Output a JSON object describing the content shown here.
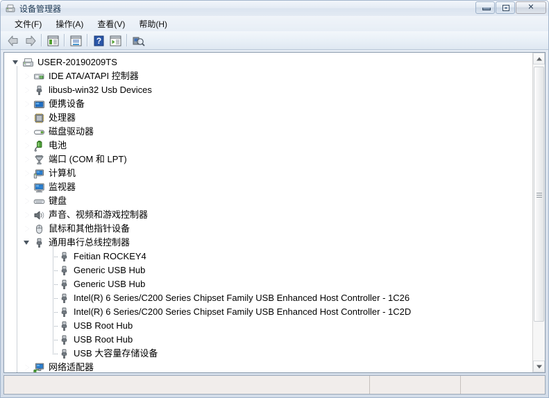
{
  "window": {
    "title": "设备管理器",
    "title_icon": "device-manager-icon",
    "buttons": {
      "minimize": "minimize-button",
      "maximize": "maximize-button",
      "close": "close-button",
      "close_glyph": "✕"
    }
  },
  "menu": {
    "items": [
      {
        "label": "文件(F)",
        "name": "menu-file"
      },
      {
        "label": "操作(A)",
        "name": "menu-action"
      },
      {
        "label": "查看(V)",
        "name": "menu-view"
      },
      {
        "label": "帮助(H)",
        "name": "menu-help"
      }
    ]
  },
  "toolbar": {
    "buttons": [
      {
        "name": "back-button",
        "icon": "back-arrow-icon"
      },
      {
        "name": "forward-button",
        "icon": "forward-arrow-icon"
      },
      {
        "name": "separator-1",
        "icon": "separator"
      },
      {
        "name": "show-hide-console-tree-button",
        "icon": "console-tree-icon"
      },
      {
        "name": "separator-2",
        "icon": "separator"
      },
      {
        "name": "properties-button",
        "icon": "properties-window-icon"
      },
      {
        "name": "separator-3",
        "icon": "separator"
      },
      {
        "name": "help-button",
        "icon": "question-mark-icon",
        "glyph": "?"
      },
      {
        "name": "update-driver-button",
        "icon": "play-window-icon"
      },
      {
        "name": "separator-4",
        "icon": "separator"
      },
      {
        "name": "scan-hardware-changes-button",
        "icon": "scan-magnifier-icon"
      }
    ]
  },
  "tree": {
    "root": {
      "label": "USER-20190209TS",
      "icon": "computer-root-icon",
      "expanded": true,
      "indent": 0
    },
    "nodes": [
      {
        "label": "IDE ATA/ATAPI 控制器",
        "icon": "ide-controller-icon",
        "state": "collapsed",
        "indent": 1
      },
      {
        "label": "libusb-win32 Usb Devices",
        "icon": "usb-plug-icon",
        "state": "collapsed",
        "indent": 1
      },
      {
        "label": "便携设备",
        "icon": "portable-device-icon",
        "state": "collapsed",
        "indent": 1
      },
      {
        "label": "处理器",
        "icon": "processor-icon",
        "state": "collapsed",
        "indent": 1
      },
      {
        "label": "磁盘驱动器",
        "icon": "disk-drive-icon",
        "state": "collapsed",
        "indent": 1
      },
      {
        "label": "电池",
        "icon": "battery-icon",
        "state": "collapsed",
        "indent": 1
      },
      {
        "label": "端口 (COM 和 LPT)",
        "icon": "ports-icon",
        "state": "collapsed",
        "indent": 1
      },
      {
        "label": "计算机",
        "icon": "computer-icon",
        "state": "collapsed",
        "indent": 1
      },
      {
        "label": "监视器",
        "icon": "monitor-icon",
        "state": "collapsed",
        "indent": 1
      },
      {
        "label": "键盘",
        "icon": "keyboard-icon",
        "state": "collapsed",
        "indent": 1
      },
      {
        "label": "声音、视频和游戏控制器",
        "icon": "sound-speaker-icon",
        "state": "collapsed",
        "indent": 1
      },
      {
        "label": "鼠标和其他指针设备",
        "icon": "mouse-icon",
        "state": "collapsed",
        "indent": 1
      },
      {
        "label": "通用串行总线控制器",
        "icon": "usb-plug-icon",
        "state": "expanded",
        "indent": 1
      },
      {
        "label": "Feitian ROCKEY4",
        "icon": "usb-plug-icon",
        "state": "leaf",
        "indent": 2
      },
      {
        "label": "Generic USB Hub",
        "icon": "usb-plug-icon",
        "state": "leaf",
        "indent": 2
      },
      {
        "label": "Generic USB Hub",
        "icon": "usb-plug-icon",
        "state": "leaf",
        "indent": 2
      },
      {
        "label": "Intel(R) 6 Series/C200 Series Chipset Family USB Enhanced Host Controller - 1C26",
        "icon": "usb-plug-icon",
        "state": "leaf",
        "indent": 2
      },
      {
        "label": "Intel(R) 6 Series/C200 Series Chipset Family USB Enhanced Host Controller - 1C2D",
        "icon": "usb-plug-icon",
        "state": "leaf",
        "indent": 2
      },
      {
        "label": "USB Root Hub",
        "icon": "usb-plug-icon",
        "state": "leaf",
        "indent": 2
      },
      {
        "label": "USB Root Hub",
        "icon": "usb-plug-icon",
        "state": "leaf",
        "indent": 2
      },
      {
        "label": "USB 大容量存储设备",
        "icon": "usb-plug-icon",
        "state": "leaf",
        "indent": 2
      },
      {
        "label": "网络适配器",
        "icon": "network-adapter-icon",
        "state": "collapsed",
        "indent": 1
      }
    ]
  },
  "scrollbar": {
    "up_name": "scroll-up-button",
    "down_name": "scroll-down-button",
    "thumb_name": "scroll-thumb"
  },
  "statusbar": {
    "cells": [
      "",
      "",
      ""
    ]
  },
  "colors": {
    "title_text": "#13314f",
    "tree_text": "#000000",
    "window_frame": "#a3b5cc",
    "client_border": "#8a9aad",
    "statusbar_bg": "#f1edeb",
    "expander_collapsed": "#9aa5b1",
    "expander_expanded": "#4a5560"
  }
}
